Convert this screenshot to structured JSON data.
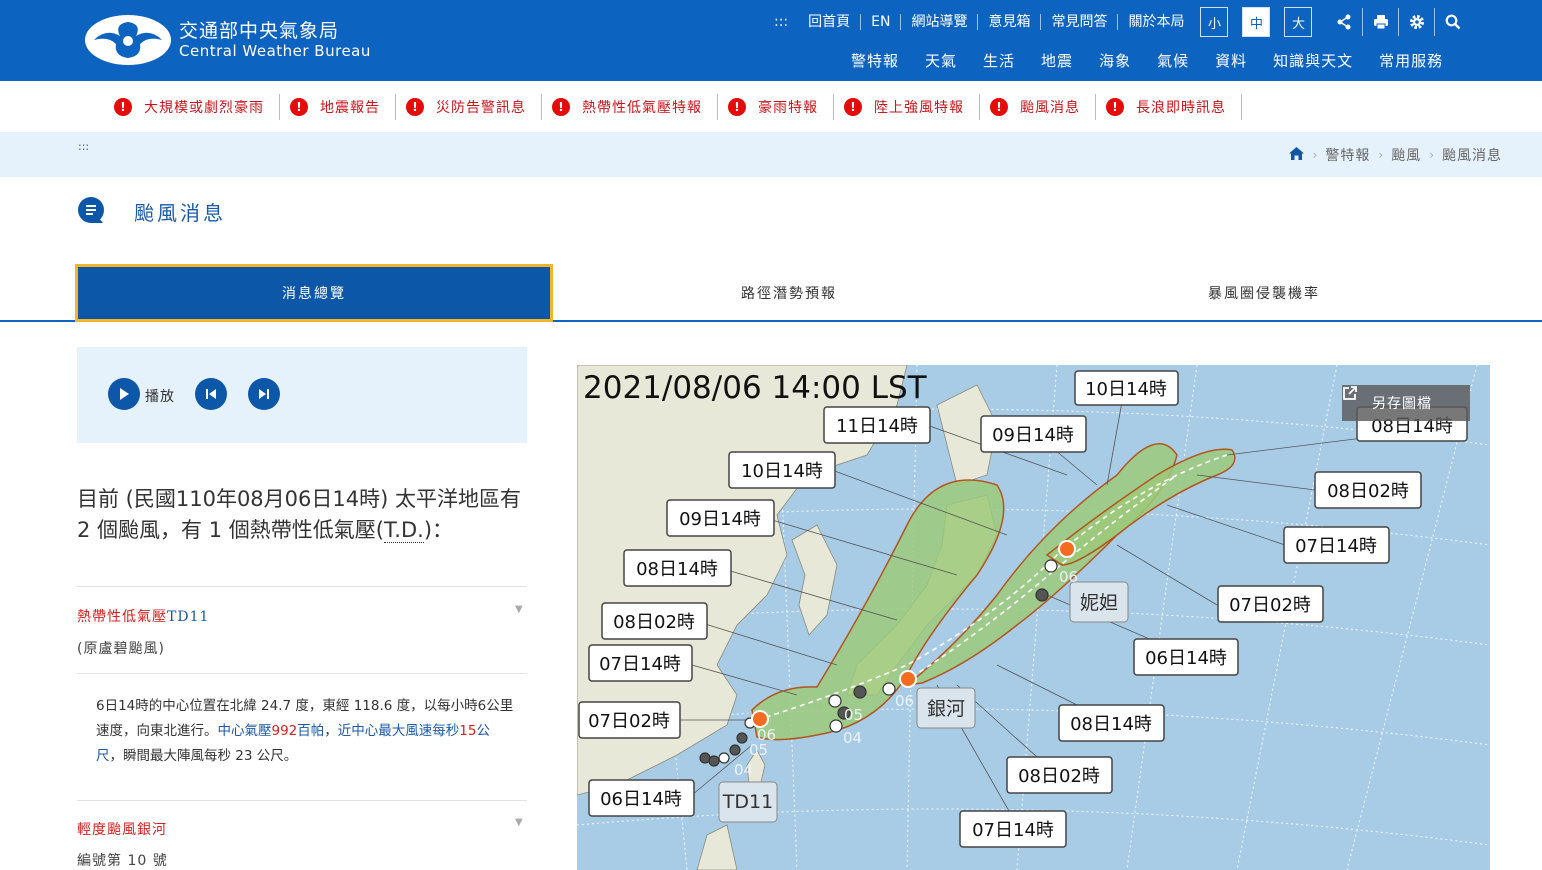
{
  "header": {
    "logo_zh": "交通部中央氣象局",
    "logo_en": "Central Weather Bureau",
    "accesskey": ":::",
    "top_links": [
      "回首頁",
      "EN",
      "網站導覽",
      "意見箱",
      "常見問答",
      "關於本局"
    ],
    "font_sizes": [
      "小",
      "中",
      "大"
    ],
    "active_font_size": "中",
    "main_nav": [
      "警特報",
      "天氣",
      "生活",
      "地震",
      "海象",
      "氣候",
      "資料",
      "知識與天文",
      "常用服務"
    ]
  },
  "alerts": [
    "大規模或劇烈豪雨",
    "地震報告",
    "災防告警訊息",
    "熱帶性低氣壓特報",
    "豪雨特報",
    "陸上強風特報",
    "颱風消息",
    "長浪即時訊息"
  ],
  "alert_mark": "!",
  "breadcrumb": {
    "accesskey": ":::",
    "items": [
      "警特報",
      "颱風",
      "颱風消息"
    ]
  },
  "page_title": "颱風消息",
  "tabs": [
    "消息總覽",
    "路徑潛勢預報",
    "暴風圈侵襲機率"
  ],
  "player": {
    "play_label": "播放"
  },
  "summary": {
    "part1": "目前 (民國110年08月06日14時) 太平洋地區有 2 個颱風，有 1 個熱帶性低氣壓(",
    "abbr": "T.D.",
    "part2": ")："
  },
  "storms": [
    {
      "name_prefix": "熱帶性低氣壓",
      "code": "TD11",
      "sub": "(原盧碧颱風)",
      "desc_a": "6日14時的中心位置在北緯 24.7 度，東經 118.6 度，以每小時6公里速度，向東北進行。",
      "desc_b": "中心氣壓",
      "desc_c": "992",
      "desc_d": "百帕",
      "desc_e": "，",
      "desc_f": "近中心最大風速每秒",
      "desc_g": "15",
      "desc_h": "公尺",
      "desc_i": "，瞬間最大陣風每秒 23 公尺。"
    },
    {
      "name_prefix": "輕度颱風銀河",
      "sub": "編號第 10 號"
    }
  ],
  "map": {
    "timestamp": "2021/08/06 14:00 LST",
    "save_label": "另存圖檔",
    "storm_labels": [
      "妮妲",
      "銀河",
      "TD11"
    ],
    "point_labels": [
      "06",
      "05",
      "04",
      "06",
      "05",
      "04",
      "06"
    ],
    "time_labels": [
      "10日14時",
      "11日14時",
      "09日14時",
      "10日14時",
      "09日14時",
      "08日14時",
      "08日02時",
      "07日14時",
      "07日02時",
      "06日14時",
      "08日02時",
      "07日14時",
      "07日02時",
      "06日14時",
      "08日14時",
      "08日02時",
      "07日14時",
      "08日14時"
    ],
    "colors": {
      "sea": "#a9cce6",
      "land": "#e8e8d8",
      "cone": "#9cc97a",
      "cone_edge": "#b3541e",
      "current": "#f36d21"
    }
  }
}
